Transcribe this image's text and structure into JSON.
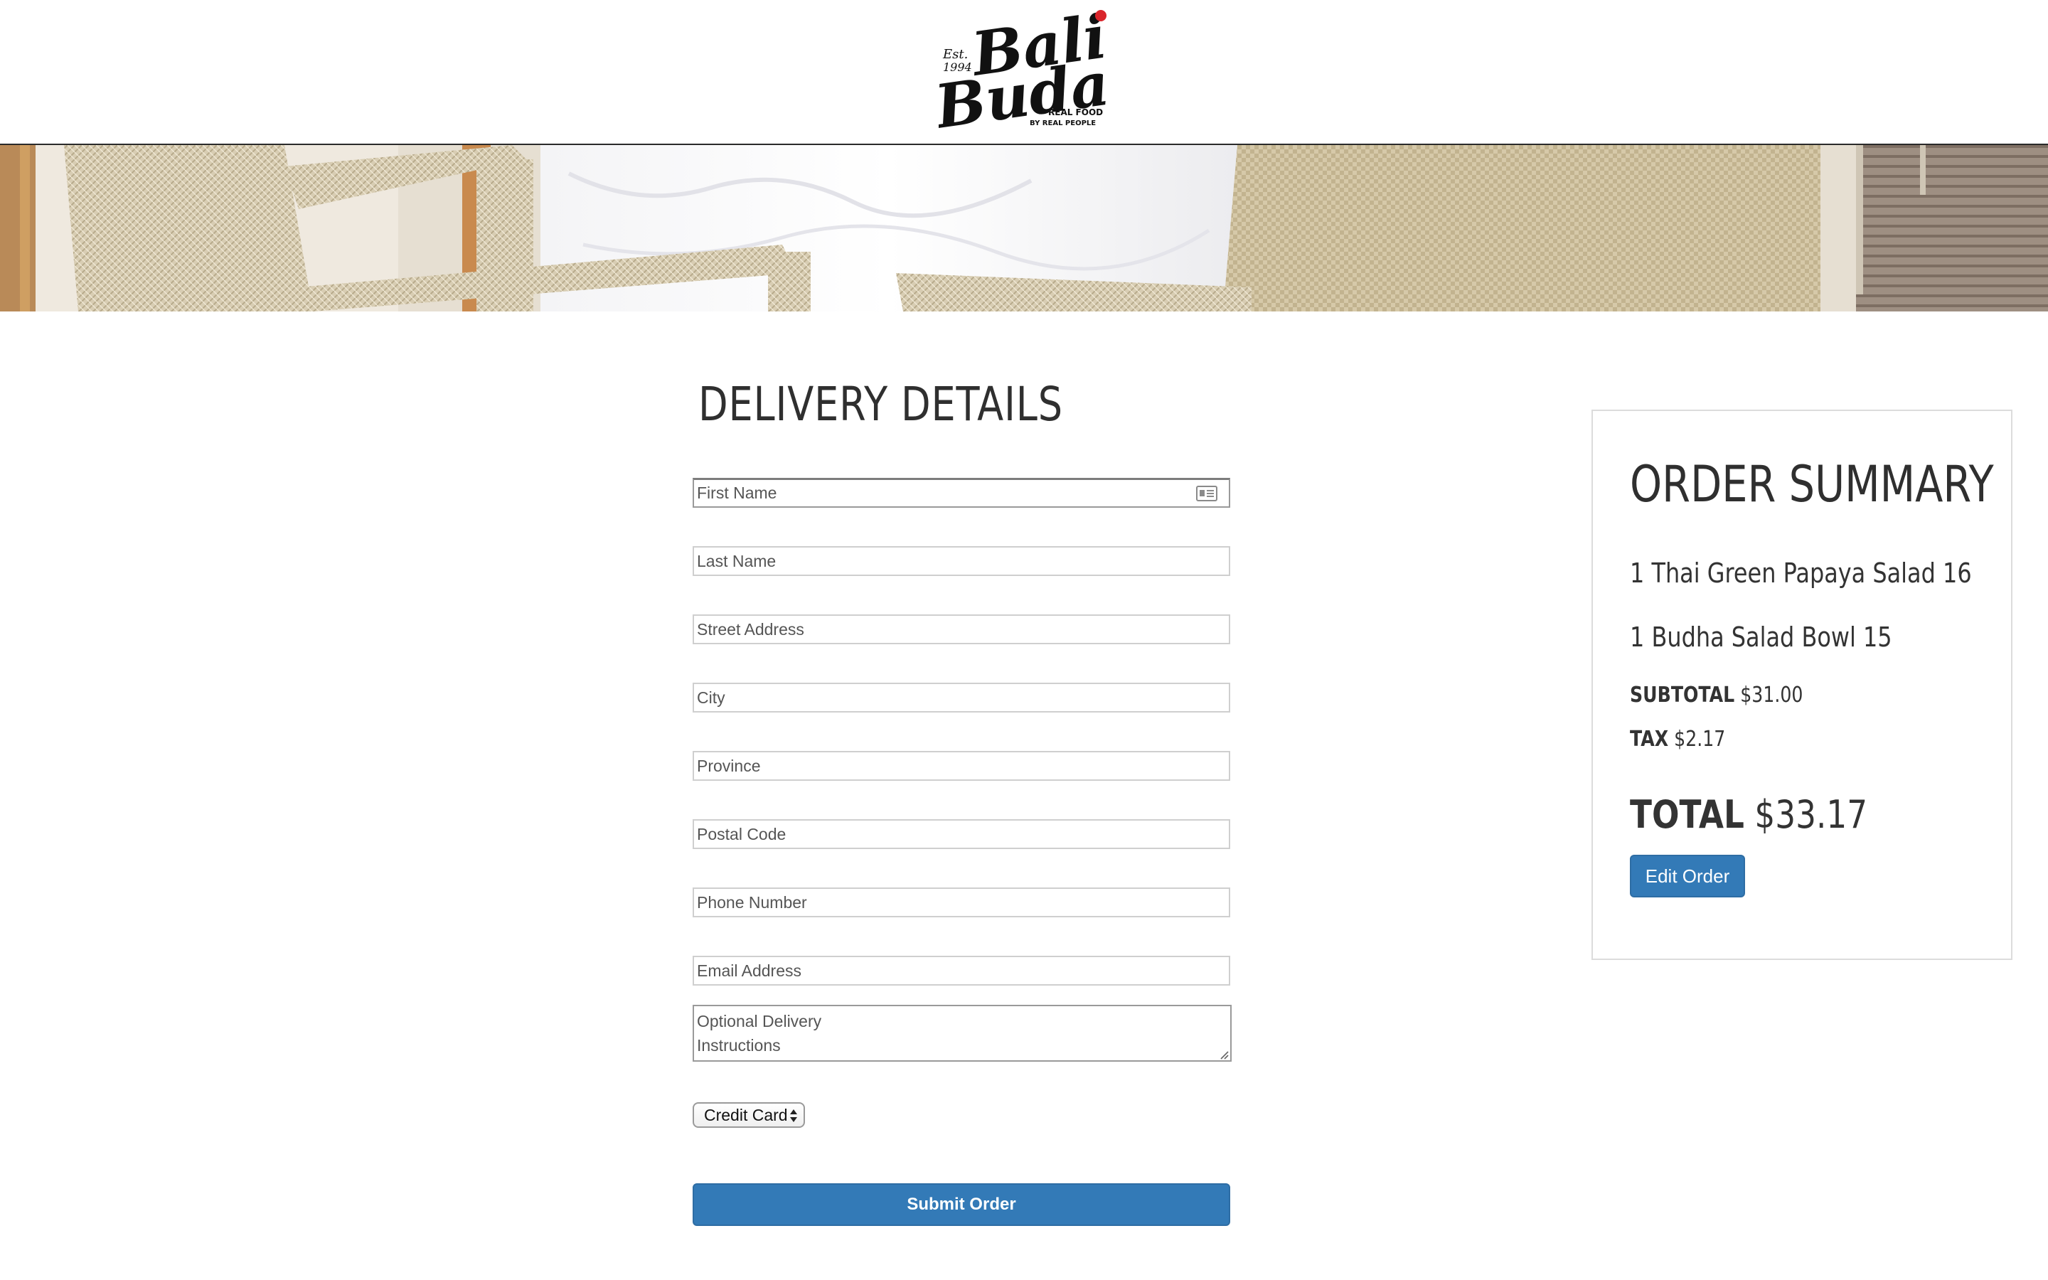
{
  "brand": {
    "logo_name": "Bali Buda",
    "logo_est": "Est.",
    "logo_year": "1994",
    "logo_tagline_1": "REAL FOOD",
    "logo_tagline_2": "BY REAL PEOPLE",
    "accent_color": "#d9252b"
  },
  "delivery": {
    "title": "DELIVERY DETAILS",
    "fields": {
      "first_name": "First Name",
      "last_name": "Last Name",
      "street": "Street Address",
      "city": "City",
      "province": "Province",
      "postal": "Postal Code",
      "phone": "Phone Number",
      "email": "Email Address",
      "instructions_line1": "Optional Delivery",
      "instructions_line2": "Instructions"
    },
    "payment_selected": "Credit Card",
    "submit_label": "Submit Order",
    "button_color": "#337ab7"
  },
  "summary": {
    "title": "ORDER SUMMARY",
    "items": [
      "1 Thai Green Papaya Salad 16",
      "1 Budha Salad Bowl 15"
    ],
    "subtotal_label": "SUBTOTAL",
    "subtotal_value": "$31.00",
    "tax_label": "TAX",
    "tax_value": "$2.17",
    "total_label": "TOTAL",
    "total_value": "$33.17",
    "edit_label": "Edit Order"
  }
}
